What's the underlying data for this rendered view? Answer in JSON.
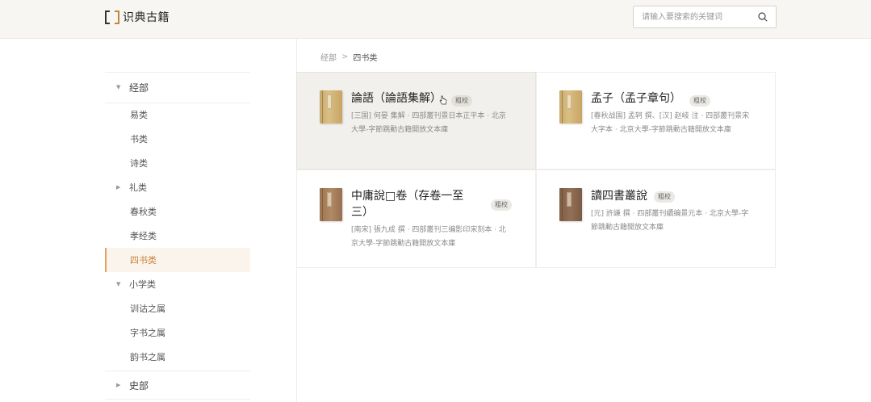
{
  "header": {
    "logo_text": "识典古籍",
    "search": {
      "placeholder": "请输入要搜索的关键词",
      "value": ""
    }
  },
  "breadcrumb": {
    "root": "经部",
    "separator": ">",
    "current": "四书类"
  },
  "sidebar": {
    "items": [
      {
        "label": "经部",
        "type": "category",
        "expanded": true
      },
      {
        "label": "易类",
        "type": "sub"
      },
      {
        "label": "书类",
        "type": "sub"
      },
      {
        "label": "诗类",
        "type": "sub"
      },
      {
        "label": "礼类",
        "type": "sub-expandable",
        "expanded": false
      },
      {
        "label": "春秋类",
        "type": "sub"
      },
      {
        "label": "孝经类",
        "type": "sub"
      },
      {
        "label": "四书类",
        "type": "sub",
        "active": true
      },
      {
        "label": "小学类",
        "type": "sub-expandable",
        "expanded": true
      },
      {
        "label": "训诂之属",
        "type": "sub"
      },
      {
        "label": "字书之属",
        "type": "sub"
      },
      {
        "label": "韵书之属",
        "type": "sub"
      },
      {
        "label": "史部",
        "type": "category",
        "expanded": false
      }
    ]
  },
  "books": [
    {
      "title": "論語（論語集解）",
      "badge": "粗校",
      "desc": "[三国] 何晏 集解 · 四部叢刊景日本正平本 · 北京大學-字節跳動古籍開放文本庫"
    },
    {
      "title": "孟子（孟子章句）",
      "badge": "粗校",
      "desc": "[春秋战国] 孟轲 撰、[汉] 赵岐 注 · 四部叢刊景宋大字本 · 北京大學-字節跳動古籍開放文本庫"
    },
    {
      "title": "中庸說□卷（存卷一至三）",
      "badge": "粗校",
      "desc": "[南宋] 張九成 撰 · 四部叢刊三编影印宋刻本 · 北京大學-字節跳動古籍開放文本庫"
    },
    {
      "title": "讀四書叢說",
      "badge": "粗校",
      "desc": "[元] 許謙 撰 · 四部叢刊續编景元本 · 北京大學-字節跳動古籍開放文本庫"
    }
  ],
  "colors": {
    "accent": "#c8823c",
    "header_bg": "#f7f6f2",
    "active_bg": "#fbf4ec"
  }
}
